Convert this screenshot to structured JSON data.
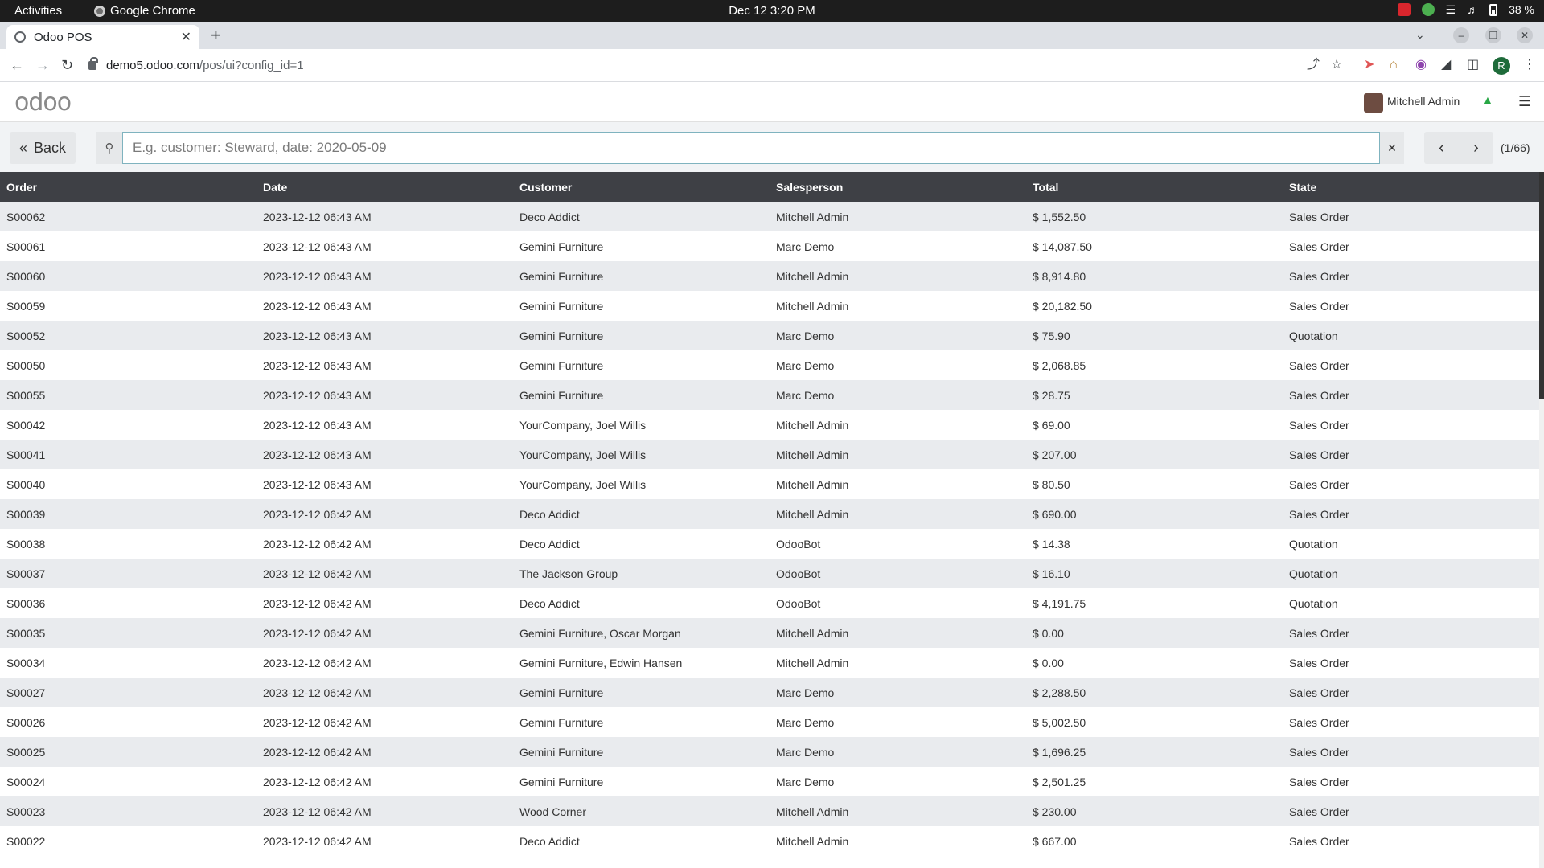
{
  "os": {
    "activities": "Activities",
    "app_name": "Google Chrome",
    "clock": "Dec 12  3:20 PM",
    "battery": "38 %"
  },
  "browser": {
    "tab_title": "Odoo POS",
    "url_host": "demo5.odoo.com",
    "url_path": "/pos/ui?config_id=1",
    "profile_initial": "R"
  },
  "header": {
    "logo": "odoo",
    "user_name": "Mitchell Admin"
  },
  "controls": {
    "back_label": "Back",
    "search_placeholder": "E.g. customer: Steward, date: 2020-05-09",
    "search_value": "",
    "pager_count": "(1/66)"
  },
  "table": {
    "columns": [
      "Order",
      "Date",
      "Customer",
      "Salesperson",
      "Total",
      "State"
    ],
    "rows": [
      [
        "S00062",
        "2023-12-12 06:43 AM",
        "Deco Addict",
        "Mitchell Admin",
        "$ 1,552.50",
        "Sales Order"
      ],
      [
        "S00061",
        "2023-12-12 06:43 AM",
        "Gemini Furniture",
        "Marc Demo",
        "$ 14,087.50",
        "Sales Order"
      ],
      [
        "S00060",
        "2023-12-12 06:43 AM",
        "Gemini Furniture",
        "Mitchell Admin",
        "$ 8,914.80",
        "Sales Order"
      ],
      [
        "S00059",
        "2023-12-12 06:43 AM",
        "Gemini Furniture",
        "Mitchell Admin",
        "$ 20,182.50",
        "Sales Order"
      ],
      [
        "S00052",
        "2023-12-12 06:43 AM",
        "Gemini Furniture",
        "Marc Demo",
        "$ 75.90",
        "Quotation"
      ],
      [
        "S00050",
        "2023-12-12 06:43 AM",
        "Gemini Furniture",
        "Marc Demo",
        "$ 2,068.85",
        "Sales Order"
      ],
      [
        "S00055",
        "2023-12-12 06:43 AM",
        "Gemini Furniture",
        "Marc Demo",
        "$ 28.75",
        "Sales Order"
      ],
      [
        "S00042",
        "2023-12-12 06:43 AM",
        "YourCompany, Joel Willis",
        "Mitchell Admin",
        "$ 69.00",
        "Sales Order"
      ],
      [
        "S00041",
        "2023-12-12 06:43 AM",
        "YourCompany, Joel Willis",
        "Mitchell Admin",
        "$ 207.00",
        "Sales Order"
      ],
      [
        "S00040",
        "2023-12-12 06:43 AM",
        "YourCompany, Joel Willis",
        "Mitchell Admin",
        "$ 80.50",
        "Sales Order"
      ],
      [
        "S00039",
        "2023-12-12 06:42 AM",
        "Deco Addict",
        "Mitchell Admin",
        "$ 690.00",
        "Sales Order"
      ],
      [
        "S00038",
        "2023-12-12 06:42 AM",
        "Deco Addict",
        "OdooBot",
        "$ 14.38",
        "Quotation"
      ],
      [
        "S00037",
        "2023-12-12 06:42 AM",
        "The Jackson Group",
        "OdooBot",
        "$ 16.10",
        "Quotation"
      ],
      [
        "S00036",
        "2023-12-12 06:42 AM",
        "Deco Addict",
        "OdooBot",
        "$ 4,191.75",
        "Quotation"
      ],
      [
        "S00035",
        "2023-12-12 06:42 AM",
        "Gemini Furniture, Oscar Morgan",
        "Mitchell Admin",
        "$ 0.00",
        "Sales Order"
      ],
      [
        "S00034",
        "2023-12-12 06:42 AM",
        "Gemini Furniture, Edwin Hansen",
        "Mitchell Admin",
        "$ 0.00",
        "Sales Order"
      ],
      [
        "S00027",
        "2023-12-12 06:42 AM",
        "Gemini Furniture",
        "Marc Demo",
        "$ 2,288.50",
        "Sales Order"
      ],
      [
        "S00026",
        "2023-12-12 06:42 AM",
        "Gemini Furniture",
        "Marc Demo",
        "$ 5,002.50",
        "Sales Order"
      ],
      [
        "S00025",
        "2023-12-12 06:42 AM",
        "Gemini Furniture",
        "Marc Demo",
        "$ 1,696.25",
        "Sales Order"
      ],
      [
        "S00024",
        "2023-12-12 06:42 AM",
        "Gemini Furniture",
        "Marc Demo",
        "$ 2,501.25",
        "Sales Order"
      ],
      [
        "S00023",
        "2023-12-12 06:42 AM",
        "Wood Corner",
        "Mitchell Admin",
        "$ 230.00",
        "Sales Order"
      ],
      [
        "S00022",
        "2023-12-12 06:42 AM",
        "Deco Addict",
        "Mitchell Admin",
        "$ 667.00",
        "Sales Order"
      ]
    ]
  }
}
